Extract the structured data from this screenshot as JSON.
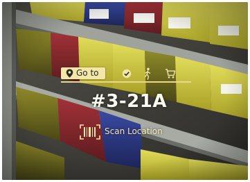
{
  "overlay": {
    "goto_label": "Go to",
    "location_code": "#3-21A",
    "scan_label": "Scan Location"
  },
  "icons": {
    "goto": "location-pin-icon",
    "step_check": "check-circle-icon",
    "step_walk": "walk-icon",
    "step_cart": "cart-icon",
    "scan": "barcode-scan-icon"
  },
  "colors": {
    "overlay_accent": "#F2E6A8",
    "overlay_text": "#FBFAF0",
    "bin_yellow": "#D8CF3C",
    "bin_red": "#8E2A2E",
    "bin_blue": "#2E3A8A"
  }
}
